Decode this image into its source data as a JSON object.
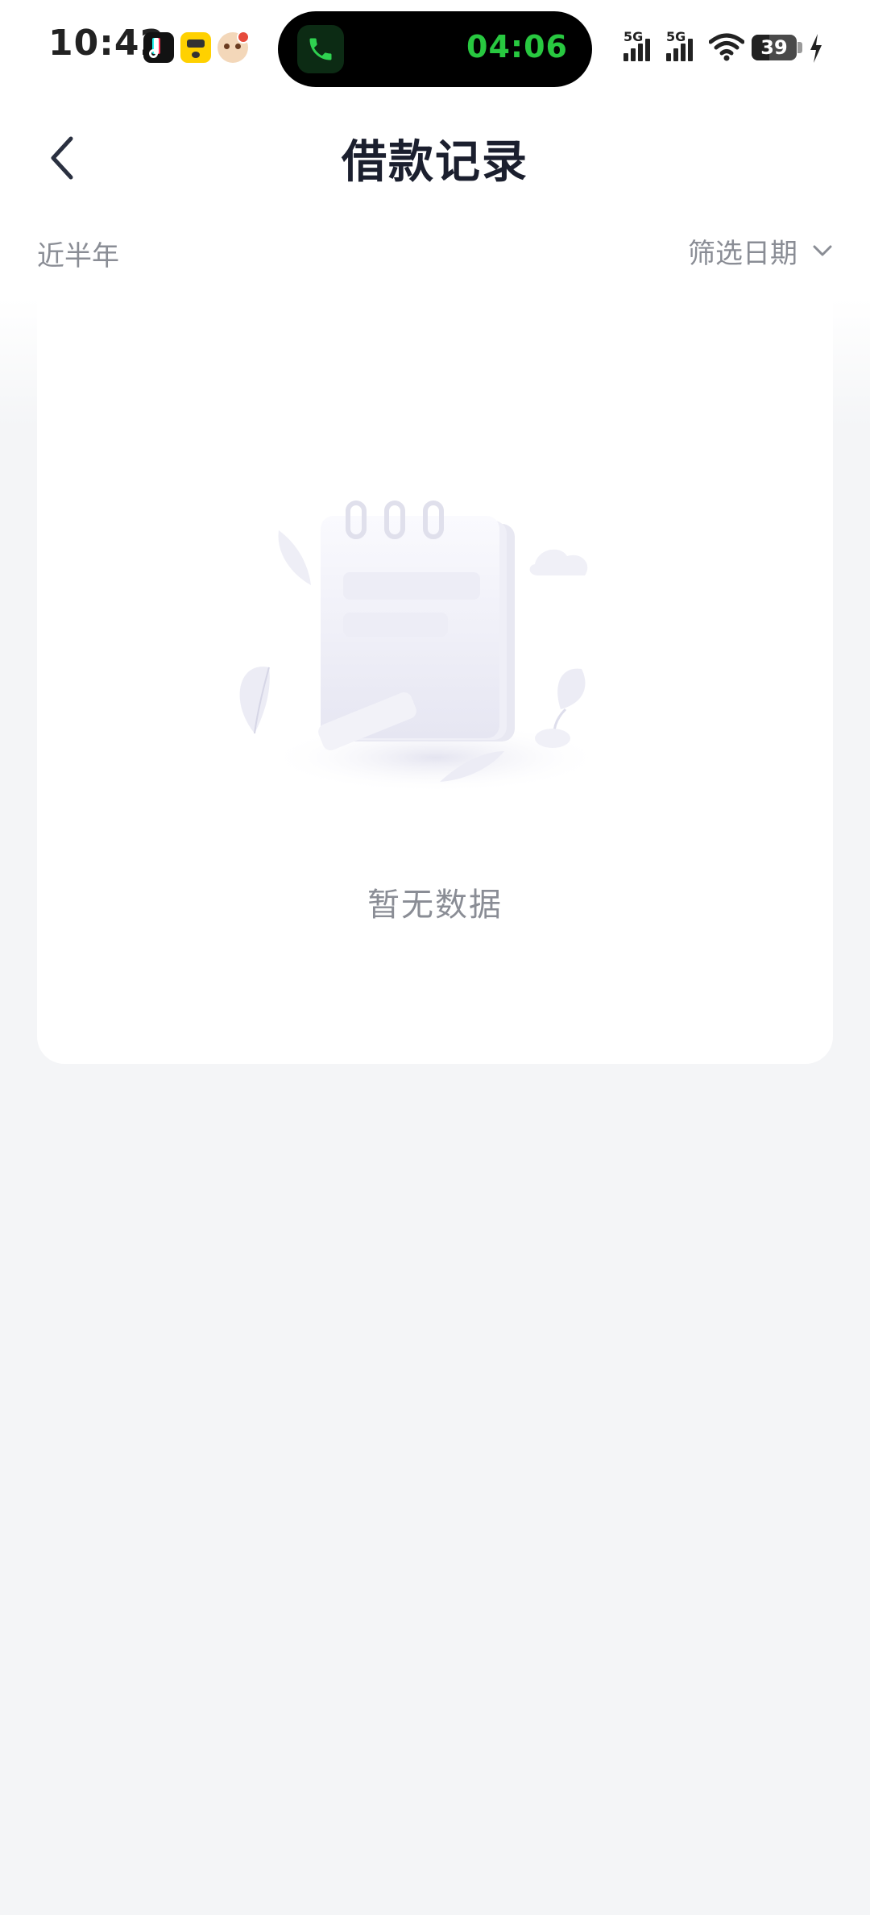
{
  "status_bar": {
    "time": "10:42",
    "call_timer": "04:06",
    "signal_1_label": "5G",
    "signal_2_label": "5G",
    "battery_percent": "39",
    "battery_level": 0.39,
    "notification_icons": [
      "tiktok-icon",
      "meituan-icon",
      "cartoon-app-icon"
    ]
  },
  "header": {
    "title": "借款记录",
    "back_icon": "chevron-left-icon"
  },
  "filter": {
    "range_label": "近半年",
    "date_filter_label": "筛选日期",
    "date_filter_icon": "chevron-down-icon"
  },
  "empty_state": {
    "message": "暂无数据",
    "illustration": "empty-notebook-illustration"
  },
  "colors": {
    "page_background": "#f4f5f7",
    "card_background": "#ffffff",
    "title_text": "#1b1f2e",
    "secondary_text": "#8a8d95",
    "call_green": "#28c840"
  }
}
